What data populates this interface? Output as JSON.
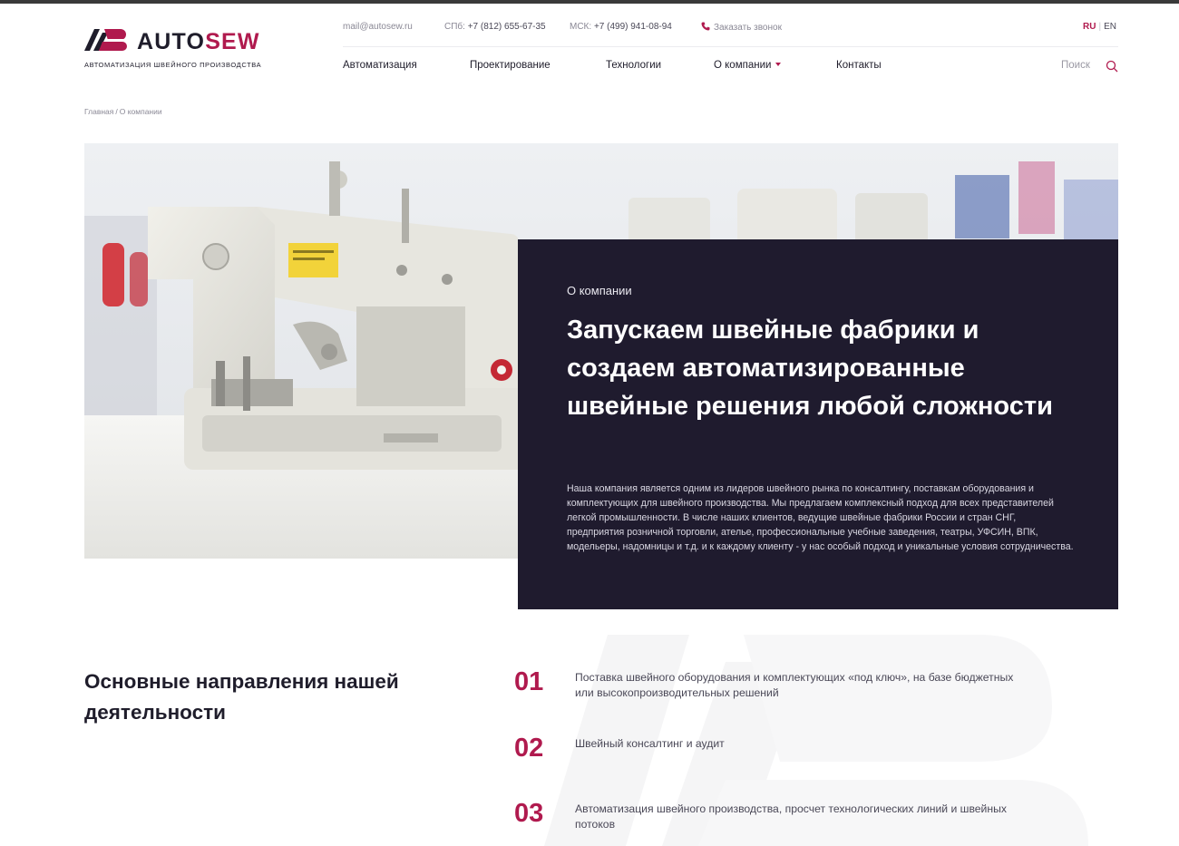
{
  "brand": {
    "word_a": "AUTO",
    "word_b": "SEW",
    "tagline": "Автоматизация швейного производства",
    "accent": "#b01a4e",
    "dark": "#1f1b2e"
  },
  "contacts": {
    "email": "mail@autosew.ru",
    "spb_label": "СПб:",
    "spb_phone": "+7 (812) 655-67-35",
    "msk_label": "МСК:",
    "msk_phone": "+7 (499) 941-08-94",
    "callback": "Заказать звонок",
    "callback_icon": "phone-icon"
  },
  "lang": {
    "ru": "RU",
    "en": "EN",
    "active": "RU"
  },
  "nav": {
    "items": [
      "Автоматизация",
      "Проектирование",
      "Технологии",
      "О компании",
      "Контакты"
    ],
    "search": "Поиск",
    "search_icon": "search-icon",
    "dropdown_icon": "caret-down-icon"
  },
  "breadcrumb": {
    "home": "Главная",
    "sep": "/",
    "current": "О компании"
  },
  "hero": {
    "image": "sewing-machine-photo",
    "eyebrow": "О компании",
    "title": "Запускаем швейные фабрики и создаем автоматизированные швейные решения любой сложности",
    "text": "Наша компания является одним из лидеров швейного рынка по консалтингу, поставкам оборудования и комплектующих для швейного производства. Мы предлагаем комплексный подход для всех представителей легкой промышленности. В числе наших клиентов, ведущие швейные фабрики России и стран СНГ, предприятия розничной торговли, ателье, профессиональные учебные заведения, театры, УФСИН, ВПК, модельеры, надомницы и т.д. и к каждому клиенту - у нас особый подход и уникальные условия сотрудничества."
  },
  "directions": {
    "title": "Основные направления нашей деятельности",
    "items": [
      {
        "num": "01",
        "text": "Поставка швейного оборудования и комплектующих «под ключ», на базе бюджетных или высокопроизводительных решений"
      },
      {
        "num": "02",
        "text": "Швейный консалтинг и аудит"
      },
      {
        "num": "03",
        "text": "Автоматизация швейного производства, просчет технологических линий и швейных потоков"
      }
    ]
  }
}
